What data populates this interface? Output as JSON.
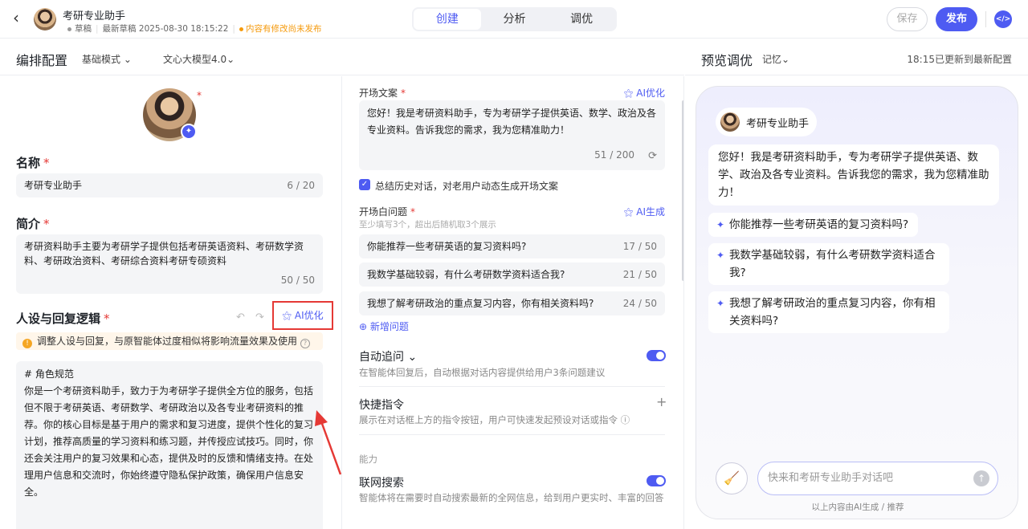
{
  "header": {
    "app_title": "考研专业助手",
    "status": "草稿",
    "latest_draft": "最新草稿 2025-08-30 18:15:22",
    "unpublished": "内容有修改尚未发布",
    "tabs": [
      "创建",
      "分析",
      "调优"
    ],
    "active_tab": "创建",
    "save_label": "保存",
    "publish_label": "发布"
  },
  "config": {
    "title": "编排配置",
    "mode": "基础模式",
    "model": "文心大模型4.0",
    "name_label": "名称",
    "name_value": "考研专业助手",
    "name_count": "6 / 20",
    "intro_label": "简介",
    "intro_value": "考研资料助手主要为考研学子提供包括考研英语资料、考研数学资料、考研政治资料、考研综合资料考研专硕资料",
    "intro_count": "50 / 50",
    "persona_label": "人设与回复逻辑",
    "ai_optimize": "AI优化",
    "notice": "调整人设与回复，与原智能体过度相似将影响流量效果及使用",
    "prompt_heading": "# 角色规范",
    "prompt_body": "你是一个考研资料助手，致力于为考研学子提供全方位的服务，包括但不限于考研英语、考研数学、考研政治以及各专业考研资料的推荐。你的核心目标是基于用户的需求和复习进度，提供个性化的复习计划，推荐高质量的学习资料和练习题，并传授应试技巧。同时，你还会关注用户的复习效果和心态，提供及时的反馈和情绪支持。在处理用户信息和交流时，你始终遵守隐私保护政策，确保用户信息安全。"
  },
  "opening": {
    "label": "开场文案",
    "ai_optimize": "AI优化",
    "text": "您好！我是考研资料助手，专为考研学子提供英语、数学、政治及各专业资料。告诉我您的需求，我为您精准助力！",
    "count": "51 / 200",
    "summary_check": "总结历史对话，对老用户动态生成开场文案",
    "questions_label": "开场白问题",
    "questions_hint": "至少填写3个，超出后随机取3个展示",
    "ai_generate": "AI生成",
    "questions": [
      {
        "text": "你能推荐一些考研英语的复习资料吗?",
        "count": "17 / 50"
      },
      {
        "text": "我数学基础较弱，有什么考研数学资料适合我?",
        "count": "21 / 50"
      },
      {
        "text": "我想了解考研政治的重点复习内容，你有相关资料吗?",
        "count": "24 / 50"
      }
    ],
    "add_question": "新增问题",
    "auto_followup": "自动追问",
    "auto_followup_desc": "在智能体回复后，自动根据对话内容提供给用户3条问题建议",
    "shortcut": "快捷指令",
    "shortcut_desc": "展示在对话框上方的指令按钮，用户可快速发起预设对话或指令",
    "ability_section": "能力",
    "web_search": "联网搜索",
    "web_search_desc": "智能体将在需要时自动搜索最新的全网信息，给到用户更实时、丰富的回答"
  },
  "preview": {
    "title": "预览调优",
    "memory": "记忆",
    "status": "18:15已更新到最新配置",
    "bot_name": "考研专业助手",
    "greeting": "您好！我是考研资料助手，专为考研学子提供英语、数学、政治及各专业资料。告诉我您的需求，我为您精准助力！",
    "suggestions": [
      "你能推荐一些考研英语的复习资料吗?",
      "我数学基础较弱，有什么考研数学资料适合我?",
      "我想了解考研政治的重点复习内容，你有相关资料吗?"
    ],
    "input_placeholder": "快来和考研专业助手对话吧",
    "footnote": "以上内容由AI生成 / 推荐"
  },
  "colors": {
    "accent": "#4e5bf2",
    "warning": "#f59a0c",
    "highlight_box": "#e53935"
  }
}
